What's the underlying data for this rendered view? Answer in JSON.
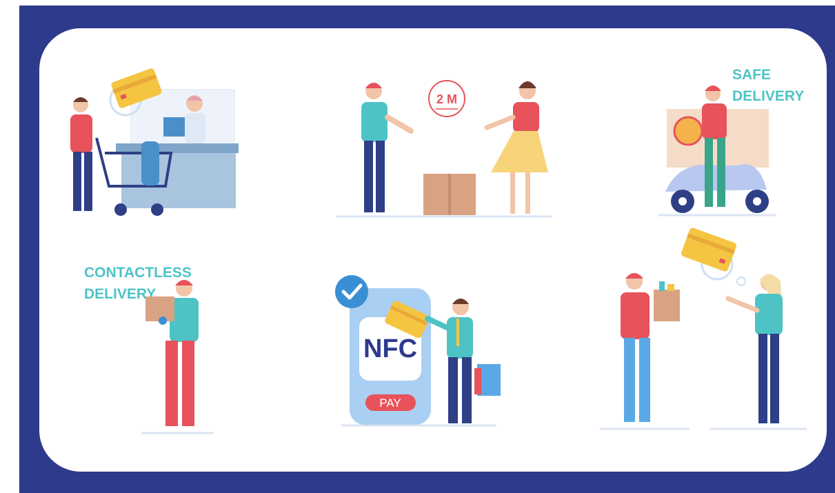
{
  "labels": {
    "distance": "2 M",
    "safe_delivery": [
      "SAFE",
      "DELIVERY"
    ],
    "contactless_delivery": [
      "CONTACTLESS",
      "DELIVERY"
    ],
    "nfc": "NFC",
    "pay": "PAY"
  },
  "colors": {
    "frame": "#2e3a8c",
    "panel": "#ffffff",
    "accent_teal": "#4ec3c6",
    "accent_red": "#e8525a",
    "card_gold": "#f5c542",
    "phone_blue": "#a9cff2",
    "check_blue": "#3a8fd4"
  },
  "scenes": [
    "checkout-counter-card-payment",
    "social-distance-parcel-handover",
    "safe-delivery-scooter",
    "contactless-delivery-courier",
    "nfc-phone-payment",
    "doorstep-delivery-card-payment"
  ]
}
